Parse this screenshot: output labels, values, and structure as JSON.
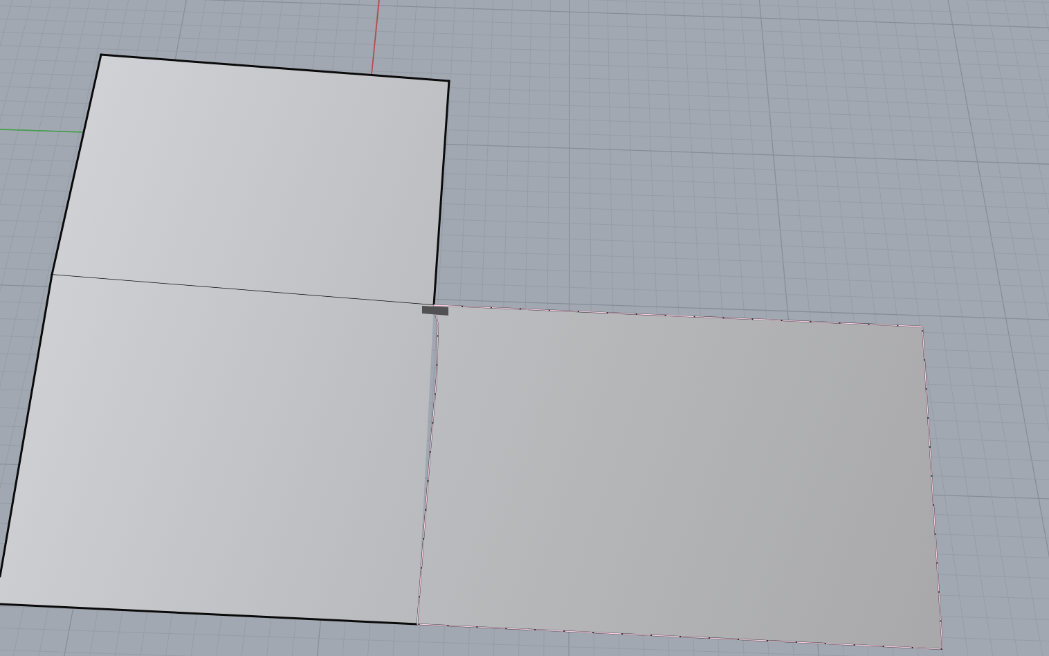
{
  "viewport": {
    "faces": [
      {
        "selected": false
      },
      {
        "selected": false
      },
      {
        "selected": true
      }
    ]
  }
}
